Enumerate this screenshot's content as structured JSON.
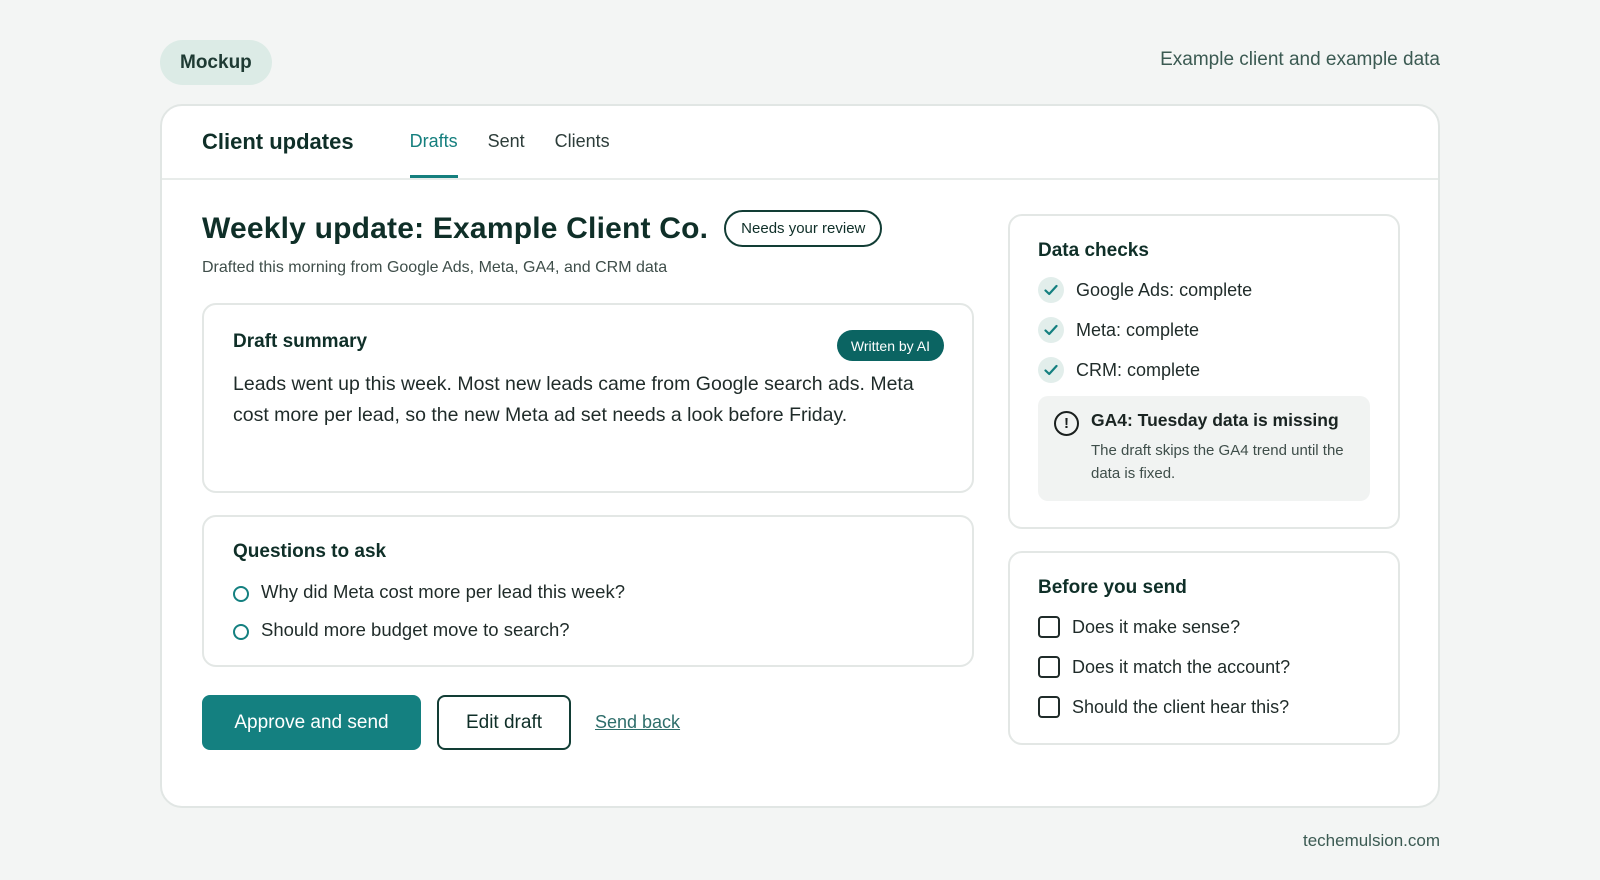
{
  "page": {
    "mockup_label": "Mockup",
    "disclaimer": "Example client and example data",
    "footer_site": "techemulsion.com"
  },
  "app": {
    "title": "Client updates",
    "tabs": [
      {
        "label": "Drafts",
        "active": true
      },
      {
        "label": "Sent",
        "active": false
      },
      {
        "label": "Clients",
        "active": false
      }
    ]
  },
  "update": {
    "title": "Weekly update: Example Client Co.",
    "status_badge": "Needs your review",
    "subtitle": "Drafted this morning from Google Ads, Meta, GA4, and CRM data"
  },
  "summary": {
    "title": "Draft summary",
    "badge": "Written by AI",
    "text": "Leads went up this week. Most new leads came from Google search ads. Meta cost more per lead, so the new Meta ad set needs a look before Friday."
  },
  "questions": {
    "title": "Questions to ask",
    "items": [
      "Why did Meta cost more per lead this week?",
      "Should more budget move to search?"
    ]
  },
  "actions": {
    "approve": "Approve and send",
    "edit": "Edit draft",
    "send_back": "Send back"
  },
  "data_checks": {
    "title": "Data checks",
    "items": [
      "Google Ads: complete",
      "Meta: complete",
      "CRM: complete"
    ],
    "warning": {
      "title": "GA4: Tuesday data is missing",
      "text": "The draft skips the GA4 trend until the data is fixed."
    }
  },
  "before_send": {
    "title": "Before you send",
    "items": [
      "Does it make sense?",
      "Does it match the account?",
      "Should the client hear this?"
    ]
  },
  "colors": {
    "accent": "#148080",
    "dark": "#0f2f28",
    "background": "#f3f5f4"
  }
}
